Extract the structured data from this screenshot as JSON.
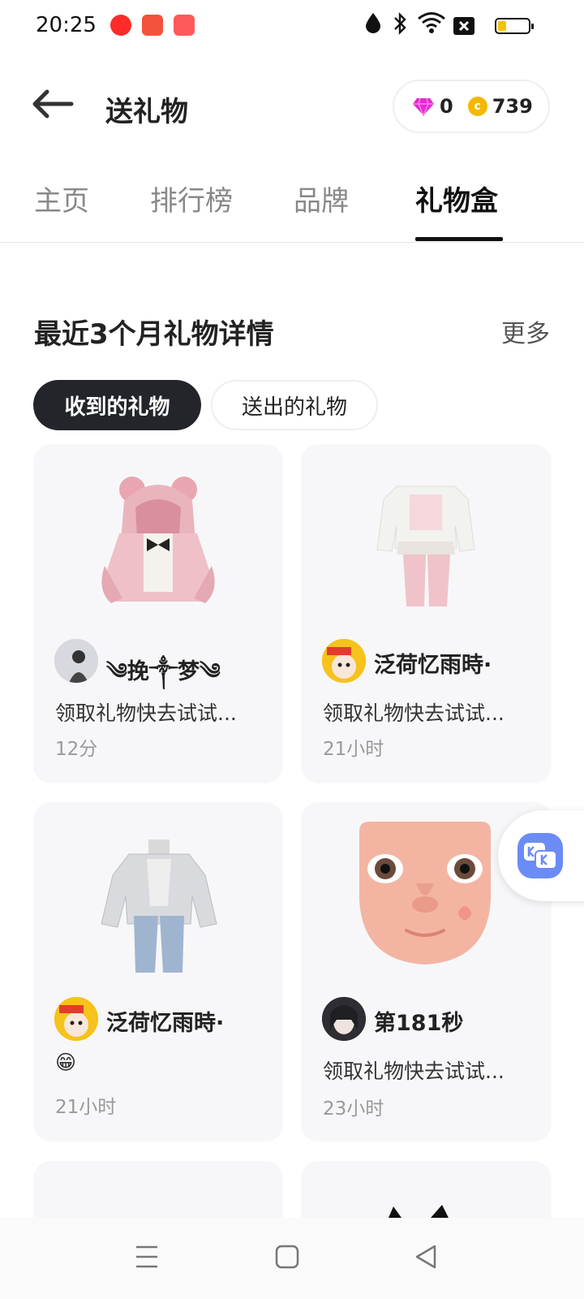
{
  "status_bar": {
    "time": "20:25"
  },
  "header": {
    "title": "送礼物",
    "diamonds": "0",
    "coins": "739",
    "coin_letter": "c"
  },
  "tabs": [
    {
      "label": "主页"
    },
    {
      "label": "排行榜"
    },
    {
      "label": "品牌"
    },
    {
      "label": "礼物盒"
    }
  ],
  "section": {
    "title": "最近3个月礼物详情",
    "more": "更多"
  },
  "segments": {
    "received": "收到的礼物",
    "sent": "送出的礼物"
  },
  "gifts": [
    {
      "user": "༄挽༒梦༄",
      "message": "领取礼物快去试试...",
      "time": "12分"
    },
    {
      "user": "泛荷忆雨時·",
      "message": "领取礼物快去试试...",
      "time": "21小时"
    },
    {
      "user": "泛荷忆雨時·",
      "message": "😁",
      "time": "21小时"
    },
    {
      "user": "第181秒",
      "message": "领取礼物快去试试...",
      "time": "23小时"
    }
  ],
  "colors": {
    "accent_dark": "#23252b",
    "diamond": "#e32bd0",
    "coin": "#f5b800",
    "chat_bubble": "#6b8cf7"
  }
}
